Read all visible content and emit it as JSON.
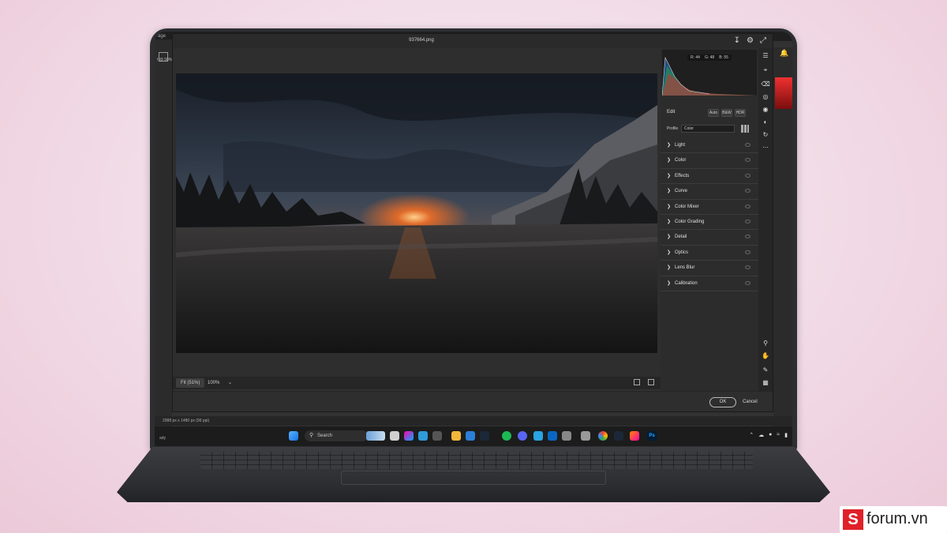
{
  "dialog": {
    "title": "937664.png"
  },
  "histogram": {
    "r_label": "R:",
    "r_value": "44",
    "g_label": "G:",
    "g_value": "48",
    "b_label": "B:",
    "b_value": "55"
  },
  "edit": {
    "label": "Edit",
    "auto": "Auto",
    "bw": "B&W",
    "hdr": "HDR"
  },
  "profile": {
    "label": "Profile",
    "value": "Color"
  },
  "sections": [
    "Light",
    "Color",
    "Effects",
    "Curve",
    "Color Mixer",
    "Color Grading",
    "Detail",
    "Optics",
    "Lens Blur",
    "Calibration"
  ],
  "canvas_bar": {
    "fit": "Fit (51%)",
    "zoom": "100%"
  },
  "footer": {
    "ok": "OK",
    "cancel": "Cancel"
  },
  "photoshop": {
    "tab_fragment": "age",
    "doc_tab": "f @ 50%",
    "status": "2988 px x 1480 px (96 ppi)",
    "status_left": "ady"
  },
  "taskbar": {
    "search": "Search",
    "ps_icon": "Ps"
  },
  "brand": {
    "logo_letter": "S",
    "logo_text": "forum.vn"
  }
}
